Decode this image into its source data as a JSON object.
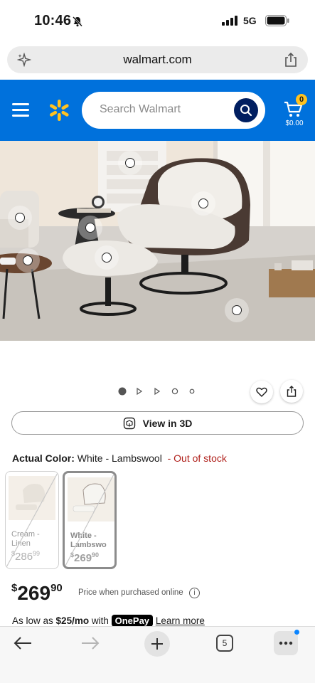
{
  "status_bar": {
    "time": "10:46",
    "network": "5G"
  },
  "browser": {
    "url": "walmart.com",
    "open_tabs": "5"
  },
  "header": {
    "search_placeholder": "Search Walmart",
    "cart_count": "0",
    "cart_total": "$0.00"
  },
  "product": {
    "view_3d_label": "View in 3D",
    "actual_color_label": "Actual Color:",
    "actual_color_value": "White - Lambswool",
    "stock_status": "- Out of stock",
    "swatches": [
      {
        "name_line1": "Cream -",
        "name_line2": "Linen",
        "price_currency": "$",
        "price_whole": "286",
        "price_cents": "99",
        "selected": false
      },
      {
        "name_line1": "White -",
        "name_line2": "Lambswo",
        "price_currency": "$",
        "price_whole": "269",
        "price_cents": "90",
        "selected": true
      }
    ],
    "price_currency": "$",
    "price_whole": "269",
    "price_cents": "90",
    "price_note": "Price when purchased online",
    "onepay_prefix": "As low as",
    "onepay_amount": "$25/mo",
    "onepay_with": "with",
    "onepay_brand": "OnePay",
    "onepay_link": "Learn more"
  },
  "colors": {
    "walmart_blue": "#0071dc",
    "spark_yellow": "#ffc220",
    "search_button": "#001e60",
    "out_of_stock_red": "#b0211c"
  }
}
